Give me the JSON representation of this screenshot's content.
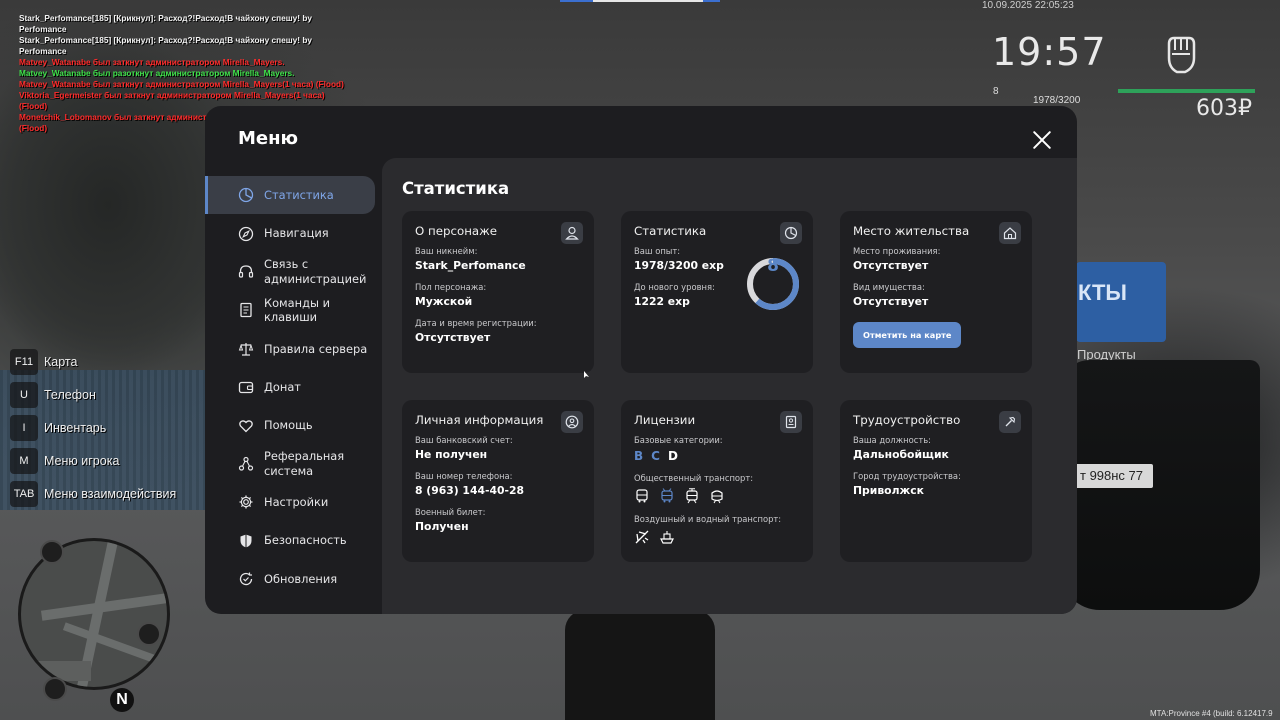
{
  "chat": [
    {
      "text": "Stark_Perfomance[185] [Крикнул]: Расход?!Расход!В чайхону спешу! by",
      "color": "white"
    },
    {
      "text": " Perfomance",
      "color": "white"
    },
    {
      "text": "Stark_Perfomance[185] [Крикнул]: Расход?!Расход!В чайхону спешу! by",
      "color": "white"
    },
    {
      "text": " Perfomance",
      "color": "white"
    },
    {
      "text": "Matvey_Watanabe был заткнут администратором Mirella_Mayers.",
      "color": "red"
    },
    {
      "text": "Matvey_Watanabe был разоткнут администратором Mirella_Mayers.",
      "color": "green"
    },
    {
      "text": "Matvey_Watanabe был заткнут администратором Mirella_Mayers(1 часа) (Flood)",
      "color": "red"
    },
    {
      "text": "Viktoria_Egermeister был заткнут администратором Mirella_Mayers(1 часа) (Flood)",
      "color": "red"
    },
    {
      "text": "Monetchik_Lobomanov был заткнут администратором Mirella_Mayers (1 часа)",
      "color": "red"
    },
    {
      "text": "(Flood)",
      "color": "red"
    }
  ],
  "hud": {
    "date": "10.09.2025 22:05:23",
    "time": "19:57",
    "money": "603₽",
    "level": "8",
    "exp": "1978/3200",
    "build": "MTA:Province #4 (build: 6.12417.9"
  },
  "keybinds": [
    {
      "key": "F11",
      "label": "Карта"
    },
    {
      "key": "U",
      "label": "Телефон"
    },
    {
      "key": "I",
      "label": "Инвентарь"
    },
    {
      "key": "M",
      "label": "Меню игрока"
    },
    {
      "key": "TAB",
      "label": "Меню взаимодействия"
    }
  ],
  "background": {
    "shop_sign": "КТЫ",
    "products_label": "Продукты",
    "plate": "т 998нс 77"
  },
  "menu": {
    "title": "Меню",
    "sidebar": [
      {
        "label": "Статистика",
        "icon": "pie-chart-icon",
        "active": true
      },
      {
        "label": "Навигация",
        "icon": "compass-icon"
      },
      {
        "label": "Связь с администрацией",
        "icon": "headset-icon"
      },
      {
        "label": "Команды и клавиши",
        "icon": "document-icon"
      },
      {
        "label": "Правила сервера",
        "icon": "scales-icon"
      },
      {
        "label": "Донат",
        "icon": "wallet-icon"
      },
      {
        "label": "Помощь",
        "icon": "heart-hand-icon"
      },
      {
        "label": "Реферальная система",
        "icon": "network-icon"
      },
      {
        "label": "Настройки",
        "icon": "gear-icon"
      },
      {
        "label": "Безопасность",
        "icon": "shield-icon"
      },
      {
        "label": "Обновления",
        "icon": "refresh-check-icon"
      }
    ],
    "content_title": "Статистика",
    "cards": {
      "character": {
        "title": "О персонаже",
        "nick_label": "Ваш никнейм:",
        "nick": "Stark_Perfomance",
        "gender_label": "Пол персонажа:",
        "gender": "Мужской",
        "reg_label": "Дата и время регистрации:",
        "reg": "Отсутствует"
      },
      "stats": {
        "title": "Статистика",
        "exp_label": "Ваш опыт:",
        "exp": "1978/3200 exp",
        "next_label": "До нового уровня:",
        "next": "1222 exp",
        "level": "8",
        "progress": 0.618
      },
      "residence": {
        "title": "Место жительства",
        "place_label": "Место проживания:",
        "place": "Отсутствует",
        "property_label": "Вид имущества:",
        "property": "Отсутствует",
        "button": "Отметить на карте"
      },
      "personal": {
        "title": "Личная информация",
        "bank_label": "Ваш банковский счет:",
        "bank": "Не получен",
        "phone_label": "Ваш номер телефона:",
        "phone": "8 (963) 144-40-28",
        "military_label": "Военный билет:",
        "military": "Получен"
      },
      "licenses": {
        "title": "Лицензии",
        "basic_label": "Базовые категории:",
        "categories": [
          "B",
          "C",
          "D"
        ],
        "public_label": "Общественный транспорт:",
        "air_label": "Воздушный и водный транспорт:"
      },
      "job": {
        "title": "Трудоустройство",
        "position_label": "Ваша должность:",
        "position": "Дальнобойщик",
        "city_label": "Город трудоустройства:",
        "city": "Приволжск"
      }
    }
  }
}
